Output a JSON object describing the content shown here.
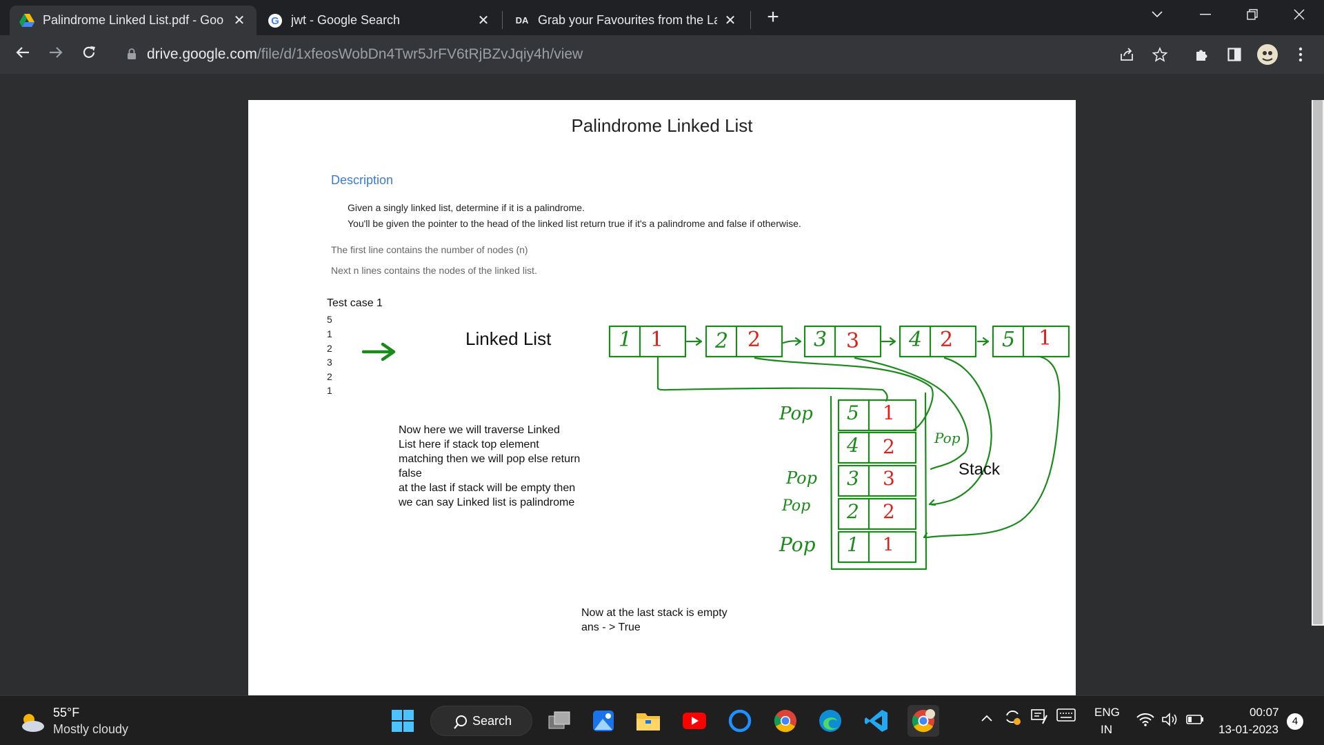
{
  "tabs": [
    {
      "title": "Palindrome Linked List.pdf - Goo",
      "active": true
    },
    {
      "title": "jwt - Google Search",
      "active": false
    },
    {
      "title": "Grab your Favourites from the La",
      "active": false
    }
  ],
  "address": {
    "host": "drive.google.com",
    "path": "/file/d/1xfeosWobDn4Twr5JrFV6tRjBZvJqiy4h/view"
  },
  "document": {
    "title": "Palindrome Linked List",
    "description_heading": "Description",
    "description_lines": [
      "Given a singly linked list, determine if it is a palindrome.",
      "You'll be given the pointer to the head of the linked list return true if it's a palindrome and false if otherwise."
    ],
    "input_lines": [
      "The first line contains the number of nodes (n)",
      "Next n lines contains the nodes of the linked list."
    ],
    "test_case_heading": "Test case 1",
    "test_case_values": [
      "5",
      "1",
      "2",
      "3",
      "2",
      "1"
    ],
    "linked_list_label": "Linked List",
    "linked_list_nodes": [
      {
        "index": "1",
        "value": "1"
      },
      {
        "index": "2",
        "value": "2"
      },
      {
        "index": "3",
        "value": "3"
      },
      {
        "index": "4",
        "value": "2"
      },
      {
        "index": "5",
        "value": "1"
      }
    ],
    "stack_label": "Stack",
    "stack_rows": [
      {
        "index": "5",
        "value": "1",
        "note": "Pop"
      },
      {
        "index": "4",
        "value": "2",
        "note": "Pop"
      },
      {
        "index": "3",
        "value": "3",
        "note": "Pop"
      },
      {
        "index": "2",
        "value": "2",
        "note": "Pop"
      },
      {
        "index": "1",
        "value": "1",
        "note": "Pop"
      }
    ],
    "explanation_lines": [
      "Now here we will traverse Linked",
      "List here if stack top element",
      "matching then we will pop else return",
      "false",
      "at the last if stack will be empty then",
      "we can say Linked list is palindrome"
    ],
    "conclusion_lines": [
      "Now at the last stack is empty",
      "ans - > True"
    ]
  },
  "taskbar": {
    "temperature": "55°F",
    "weather": "Mostly cloudy",
    "search_label": "Search",
    "lang_top": "ENG",
    "lang_bottom": "IN",
    "time": "00:07",
    "date": "13-01-2023",
    "notifications": "4"
  }
}
